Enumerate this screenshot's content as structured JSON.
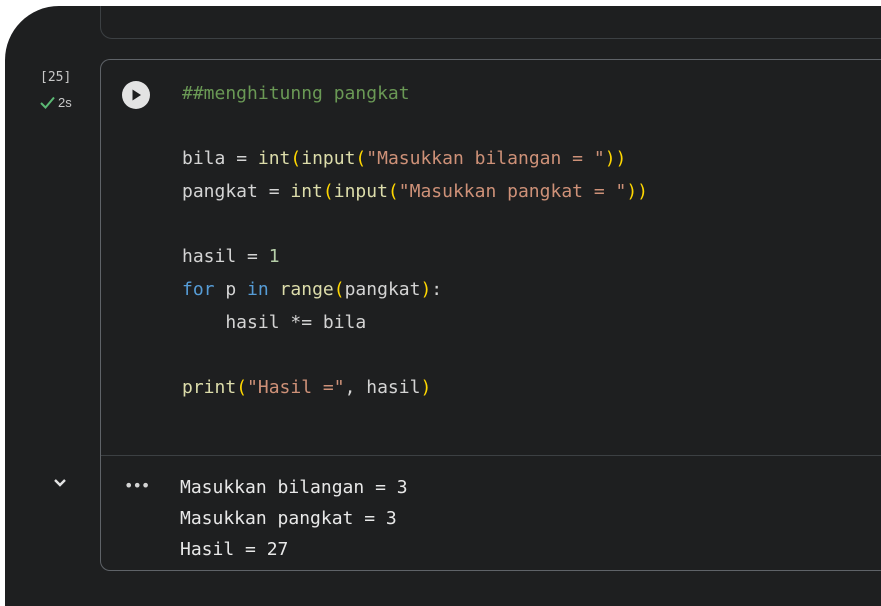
{
  "cell": {
    "execution_count": "[25]",
    "status_duration": "2s",
    "status_icon": "check-icon",
    "run_icon": "play-circle-icon",
    "code_lines": [
      [
        {
          "t": "##menghitunng pangkat",
          "c": "cm"
        }
      ],
      [],
      [
        {
          "t": "bila",
          "c": "v"
        },
        {
          "t": " = ",
          "c": "v"
        },
        {
          "t": "int",
          "c": "fn"
        },
        {
          "t": "(",
          "c": "br"
        },
        {
          "t": "input",
          "c": "fn"
        },
        {
          "t": "(",
          "c": "br"
        },
        {
          "t": "\"Masukkan bilangan = \"",
          "c": "st"
        },
        {
          "t": "))",
          "c": "br"
        }
      ],
      [
        {
          "t": "pangkat",
          "c": "v"
        },
        {
          "t": " = ",
          "c": "v"
        },
        {
          "t": "int",
          "c": "fn"
        },
        {
          "t": "(",
          "c": "br"
        },
        {
          "t": "input",
          "c": "fn"
        },
        {
          "t": "(",
          "c": "br"
        },
        {
          "t": "\"Masukkan pangkat = \"",
          "c": "st"
        },
        {
          "t": "))",
          "c": "br"
        }
      ],
      [],
      [
        {
          "t": "hasil",
          "c": "v"
        },
        {
          "t": " = ",
          "c": "v"
        },
        {
          "t": "1",
          "c": "nm"
        }
      ],
      [
        {
          "t": "for",
          "c": "kw"
        },
        {
          "t": " p ",
          "c": "v"
        },
        {
          "t": "in",
          "c": "kw"
        },
        {
          "t": " ",
          "c": "v"
        },
        {
          "t": "range",
          "c": "fn"
        },
        {
          "t": "(",
          "c": "br"
        },
        {
          "t": "pangkat",
          "c": "v"
        },
        {
          "t": ")",
          "c": "br"
        },
        {
          "t": ":",
          "c": "v"
        }
      ],
      [
        {
          "t": "    hasil *= bila",
          "c": "v"
        }
      ],
      [],
      [
        {
          "t": "print",
          "c": "fn"
        },
        {
          "t": "(",
          "c": "br"
        },
        {
          "t": "\"Hasil =\"",
          "c": "st"
        },
        {
          "t": ", hasil",
          "c": "v"
        },
        {
          "t": ")",
          "c": "br"
        }
      ]
    ]
  },
  "output": {
    "collapse_icon": "chevron-down-icon",
    "menu_icon": "more-horizontal-icon",
    "menu_label": "•••",
    "lines": [
      "Masukkan bilangan = 3",
      "Masukkan pangkat = 3",
      "Hasil = 27"
    ]
  },
  "colors": {
    "background": "#1e1f20",
    "comment": "#6a9955",
    "function": "#dcdcaa",
    "bracket": "#ffd700",
    "string": "#ce9178",
    "number": "#b5cea8",
    "keyword": "#569cd6",
    "success": "#5bb974"
  }
}
